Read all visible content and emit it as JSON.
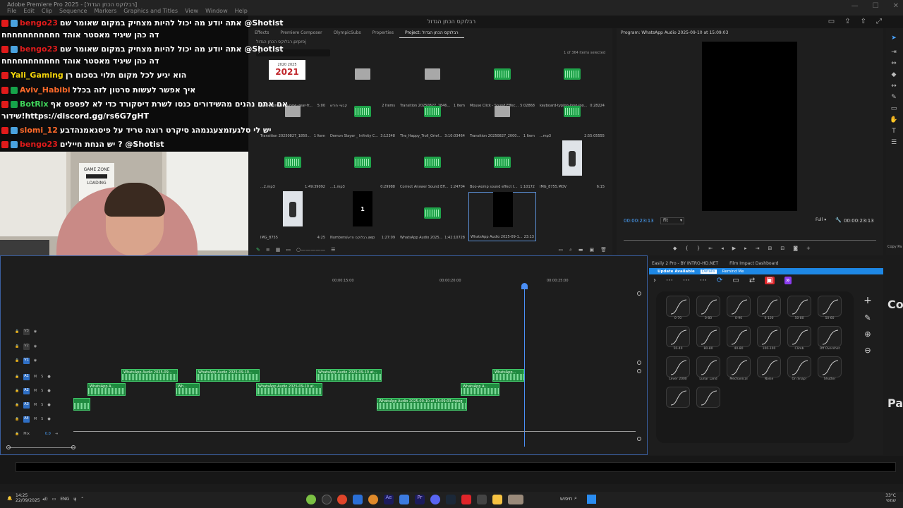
{
  "window": {
    "title": "Adobe Premiere Pro 2025 - [רבלוקס הכחן הגדול]",
    "menus": [
      "File",
      "Edit",
      "Clip",
      "Sequence",
      "Markers",
      "Graphics and Titles",
      "View",
      "Window",
      "Help"
    ],
    "sequence_title": "רבלוקס הכחן הגדול"
  },
  "chat": {
    "messages": [
      {
        "user": "bengo23",
        "color": "#e01b1b",
        "text": "אתה יודע מה יכול להיות מצחיק במקום שאומר שם @Shotist",
        "wrap": "דה כהן שיגיד מאסטר אוהד חחחחחחחחחחח"
      },
      {
        "user": "bengo23",
        "color": "#e01b1b",
        "text": "אתה יודע מה יכול להיות מצחיק במקום שאומר שם @Shotist",
        "wrap": "דה כהן שיגיד מאסטר אוהד חחחחחחחחחחח"
      },
      {
        "user": "Yali_Gaming",
        "color": "#f5d50a",
        "text": "הוא יגיע לכל מקום תלוי בסכום רן"
      },
      {
        "user": "Aviv_Habibi",
        "color": "#ff6a2a",
        "text": "איך אפשר לעשות סרטון לזה בכלל"
      },
      {
        "user": "BotRix",
        "color": "#3fd35a",
        "text": "אם אתם נהנים מהשידורים כנסו לשרת דיסקורד כדי לא לפספס אף",
        "wrap": "שידור!https://discord.gg/rs6G7gHT"
      },
      {
        "user": "slomi_12",
        "color": "#ff6a2a",
        "text": "יש לי סלגעזמצעגנמהג סיקרט רוצה טריד על פיסגאמנהדבע"
      },
      {
        "user": "bengo23",
        "color": "#e01b1b",
        "text": "יש הנחת חיילים ? @Shotist"
      }
    ]
  },
  "webcam": {
    "poster_line1": "GAME ZONE",
    "poster_line2": "LOADING"
  },
  "project": {
    "tabs": [
      "Effects",
      "Premiere Composer",
      "OlympicSubs",
      "Properties",
      "Project: רבלוקס הכחן הגדול"
    ],
    "path": "רבלוקס הכחן הגדול.prproj",
    "selected_count": "1 of 364 items selected",
    "items": [
      {
        "name": "past-represents-new-year-fr...",
        "info": "5:00",
        "kind": "image"
      },
      {
        "name": "קבציי חודש",
        "info": "2 Items",
        "kind": "folder"
      },
      {
        "name": "Transition 20250827_1846...",
        "info": "1 Item",
        "kind": "folder"
      },
      {
        "name": "Mouse Click - Sound Effec...",
        "info": "5:02868",
        "kind": "audio"
      },
      {
        "name": "keyboard-typing-long-loo...",
        "info": "0:28224",
        "kind": "audio"
      },
      {
        "name": "Transition 20250827_1850...",
        "info": "1 Item",
        "kind": "folder"
      },
      {
        "name": "Demon Slayer _ Infinity C...",
        "info": "3:12348",
        "kind": "audio"
      },
      {
        "name": "The_Happy_Troll_Grief...",
        "info": "3:10:03464",
        "kind": "audio"
      },
      {
        "name": "Transition 20250827_2000...",
        "info": "1 Item",
        "kind": "folder"
      },
      {
        "name": "...mp3",
        "info": "2:55:05555",
        "kind": "audio"
      },
      {
        "name": "...2.mp3",
        "info": "1:49:39092",
        "kind": "audio"
      },
      {
        "name": "...1.mp3",
        "info": "0:29988",
        "kind": "audio"
      },
      {
        "name": "Correct Answer Sound Eff...",
        "info": "1:24704",
        "kind": "audio"
      },
      {
        "name": "Boo-womp sound effect t...",
        "info": "1:10172",
        "kind": "audio"
      },
      {
        "name": "IMG_8755.MOV",
        "info": "6:15",
        "kind": "video"
      },
      {
        "name": "IMG_8755",
        "info": "4:25",
        "kind": "video"
      },
      {
        "name": "Numbers/רבלוקס חדש.aep",
        "info": "1:27:09",
        "kind": "black"
      },
      {
        "name": "WhatsApp Audio 2025...",
        "info": "1:42:10728",
        "kind": "audio"
      },
      {
        "name": "WhatsApp Audio 2025-09-1...",
        "info": "23:13",
        "kind": "black"
      }
    ],
    "year_text": "2021",
    "year_small": "2020 2025",
    "number_badge": "1"
  },
  "program": {
    "title": "Program: WhatsApp Audio 2025-09-10 at 15:09:03",
    "timecode_left": "00:00:23:13",
    "fit": "Fit",
    "full": "Full",
    "timecode_right": "00:00:23:13"
  },
  "timeline": {
    "ruler": [
      "00:00:15:00",
      "00:00:20:00",
      "00:00:25:00"
    ],
    "tracks": [
      {
        "name": "V3",
        "type": "video"
      },
      {
        "name": "V2",
        "type": "video"
      },
      {
        "name": "V1",
        "type": "video"
      },
      {
        "name": "A1",
        "type": "audio"
      },
      {
        "name": "A2",
        "type": "audio"
      },
      {
        "name": "A3",
        "type": "audio"
      },
      {
        "name": "A4",
        "type": "audio"
      }
    ],
    "mix_label": "Mix",
    "mix_value": "0.0",
    "clips": [
      {
        "label": "WhatsApp Audio 2025-09...",
        "track": "A1"
      },
      {
        "label": "WhatsApp Audio 2025-09-10...",
        "track": "A1"
      },
      {
        "label": "WhatsApp Audio 2025-09-10 at...",
        "track": "A1"
      },
      {
        "label": "WhatsApp...",
        "track": "A1"
      },
      {
        "label": "WhatsApp A...",
        "track": "A2"
      },
      {
        "label": "Wh...",
        "track": "A2"
      },
      {
        "label": "WhatsApp Audio 2025-09-10 at...",
        "track": "A2"
      },
      {
        "label": "WhatsApp A...",
        "track": "A2"
      },
      {
        "label": "",
        "track": "A3"
      },
      {
        "label": "WhatsApp Audio 2025-09-10 at 15:09:03.mpeg",
        "track": "A3"
      }
    ]
  },
  "easily": {
    "tabs": [
      "Easily 2 Pro - BY INTRO-HD.NET",
      "Film Impact Dashboard"
    ],
    "update_text": "Update Available",
    "details": "Details",
    "remind": "Remind Me",
    "curves": [
      "0-70",
      "0-80",
      "0-90",
      "0-100",
      "50-80",
      "50-60",
      "50-40",
      "80-80",
      "40-80",
      "100-100",
      "Climb",
      "Off Overshot",
      "Lever 2000",
      "Lunar Land",
      "Mechanical",
      "Noise",
      "On Snap!",
      "Shutter",
      "",
      ""
    ]
  },
  "rightstrip": {
    "co": "Co",
    "pa": "Pa",
    "copy": "Copy Pa"
  },
  "taskbar": {
    "time": "14:25",
    "date": "22/09/2025",
    "lang": "ENG",
    "search": "חיפוש",
    "temp": "33°C",
    "weather": "שמשי"
  }
}
